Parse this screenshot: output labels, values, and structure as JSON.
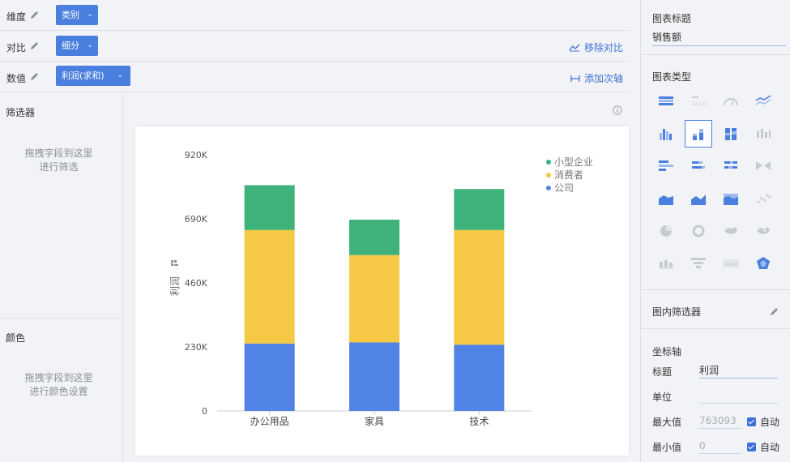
{
  "rows": [
    {
      "label": "维度",
      "pill": "类别"
    },
    {
      "label": "对比",
      "pill": "细分",
      "action": "移除对比"
    },
    {
      "label": "数值",
      "pill": "利润(求和)",
      "action": "添加次轴"
    }
  ],
  "side": {
    "filter_title": "筛选器",
    "filter_hint_1": "拖拽字段到这里",
    "filter_hint_2": "进行筛选",
    "color_title": "颜色",
    "color_hint_1": "拖拽字段到这里",
    "color_hint_2": "进行颜色设置"
  },
  "right": {
    "chart_title_label": "图表标题",
    "chart_title_value": "销售额",
    "chart_type_label": "图表类型",
    "inner_filter_label": "图内筛选器",
    "axis_label": "坐标轴",
    "axis_title_label": "标题",
    "axis_title_value": "利润",
    "unit_label": "单位",
    "unit_value": "",
    "max_label": "最大值",
    "max_value": "763093",
    "min_label": "最小值",
    "min_value": "0",
    "auto_label": "自动",
    "chart_types": [
      "table",
      "kpi",
      "gauge",
      "line-multi",
      "bar",
      "stacked-bar",
      "stacked-bar-100",
      "range-bar",
      "hbar",
      "hbar-stacked",
      "hbar-100",
      "butterfly",
      "area",
      "area-stacked",
      "area-100",
      "scatter",
      "pie",
      "ring",
      "map",
      "map-bubble",
      "boxplot",
      "funnel",
      "wordcloud",
      "radar"
    ],
    "selected_type": "stacked-bar"
  },
  "colors": {
    "accent": "#4a7fdf",
    "green": "#3eb27a",
    "yellow": "#f5c945",
    "blue": "#5283e6"
  },
  "chart_data": {
    "type": "bar",
    "stacked": true,
    "categories": [
      "办公用品",
      "家具",
      "技术"
    ],
    "series": [
      {
        "name": "公司",
        "values": [
          242000,
          246000,
          238000
        ]
      },
      {
        "name": "消费者",
        "values": [
          408000,
          314000,
          412000
        ]
      },
      {
        "name": "小型企业",
        "values": [
          161000,
          127000,
          147000
        ]
      }
    ],
    "legend_order": [
      "小型企业",
      "消费者",
      "公司"
    ],
    "yticks": [
      "0",
      "230K",
      "460K",
      "690K",
      "920K"
    ],
    "ylim": [
      0,
      920000
    ],
    "ylabel": "利润",
    "legend_position": "top-right",
    "grid": false
  }
}
